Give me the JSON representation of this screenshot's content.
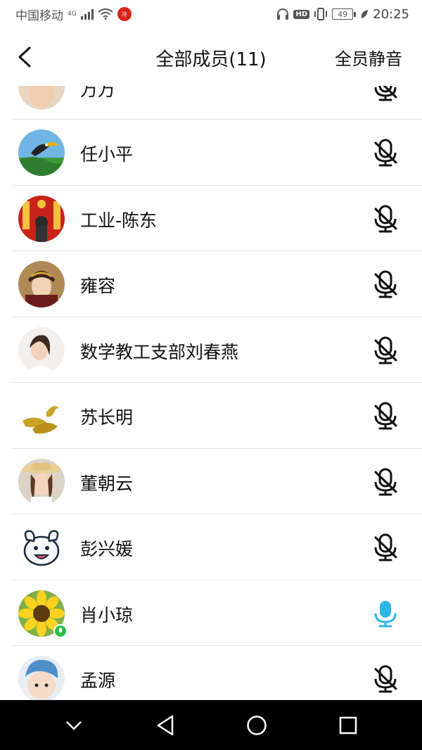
{
  "status_bar": {
    "carrier": "中国移动",
    "network": "4G",
    "notification_text": "冷",
    "hd_label": "HD",
    "battery_level": "49",
    "time": "20:25"
  },
  "header": {
    "title": "全部成员(11)",
    "mute_all_label": "全员静音"
  },
  "members": [
    {
      "name": "万万",
      "mic_state": "muted",
      "avatar": "woman-partial"
    },
    {
      "name": "任小平",
      "mic_state": "muted",
      "avatar": "toucan-landscape"
    },
    {
      "name": "工业-陈东",
      "mic_state": "muted",
      "avatar": "red-festive"
    },
    {
      "name": "雍容",
      "mic_state": "muted",
      "avatar": "woman-costume"
    },
    {
      "name": "数学教工支部刘春燕",
      "mic_state": "muted",
      "avatar": "woman-portrait"
    },
    {
      "name": "苏长明",
      "mic_state": "muted",
      "avatar": "golden-phoenix"
    },
    {
      "name": "董朝云",
      "mic_state": "muted",
      "avatar": "woman-hat"
    },
    {
      "name": "彭兴媛",
      "mic_state": "muted",
      "avatar": "cartoon-dog"
    },
    {
      "name": "肖小琼",
      "mic_state": "speaking",
      "avatar": "sunflower"
    },
    {
      "name": "孟源",
      "mic_state": "muted",
      "avatar": "baby-hat"
    }
  ],
  "colors": {
    "mic_muted": "#111111",
    "mic_active": "#2fb6e8",
    "speaking_badge": "#2fbf4a",
    "divider": "#e6e6e6",
    "nav_bar": "#000000"
  }
}
